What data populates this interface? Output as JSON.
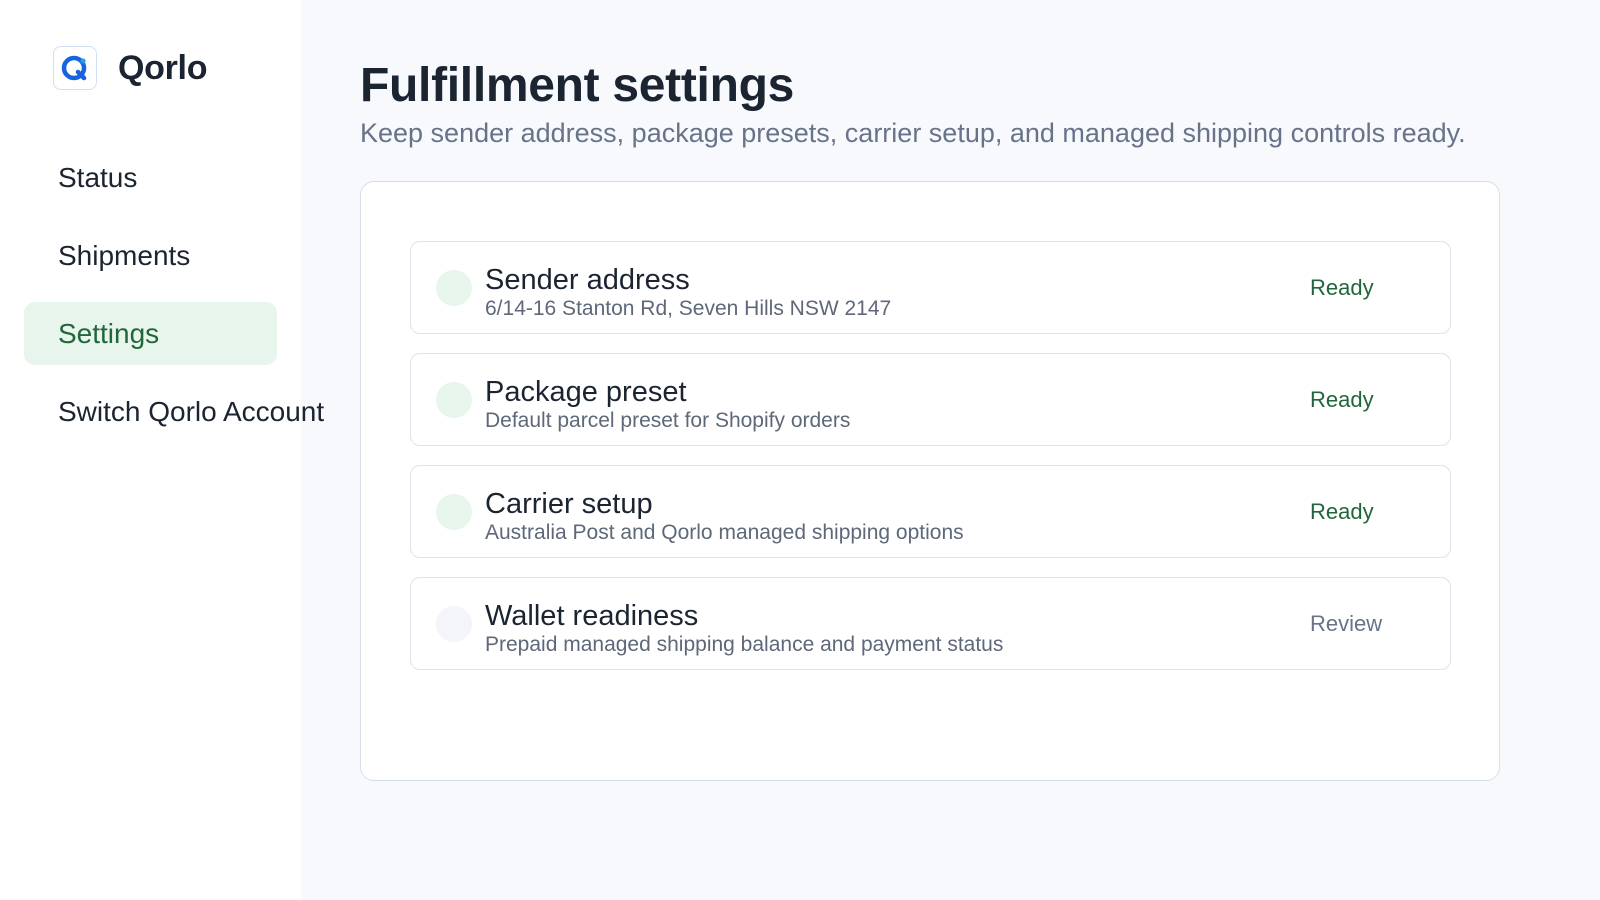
{
  "brand": {
    "name": "Qorlo",
    "accent": "#1565e0"
  },
  "sidebar": {
    "items": [
      {
        "label": "Status",
        "active": false
      },
      {
        "label": "Shipments",
        "active": false
      },
      {
        "label": "Settings",
        "active": true
      },
      {
        "label": "Switch Qorlo Account",
        "active": false
      }
    ]
  },
  "header": {
    "title": "Fulfillment settings",
    "subtitle": "Keep sender address, package presets, carrier setup, and managed shipping controls ready."
  },
  "settings": {
    "rows": [
      {
        "title": "Sender address",
        "description": "6/14-16 Stanton Rd, Seven Hills NSW 2147",
        "status": "Ready"
      },
      {
        "title": "Package preset",
        "description": "Default parcel preset for Shopify orders",
        "status": "Ready"
      },
      {
        "title": "Carrier setup",
        "description": "Australia Post and Qorlo managed shipping options",
        "status": "Ready"
      },
      {
        "title": "Wallet readiness",
        "description": "Prepaid managed shipping balance and payment status",
        "status": "Review"
      }
    ]
  },
  "colors": {
    "ready": "#22663b",
    "review": "#68738a",
    "active_nav_bg": "#e8f5ec"
  }
}
